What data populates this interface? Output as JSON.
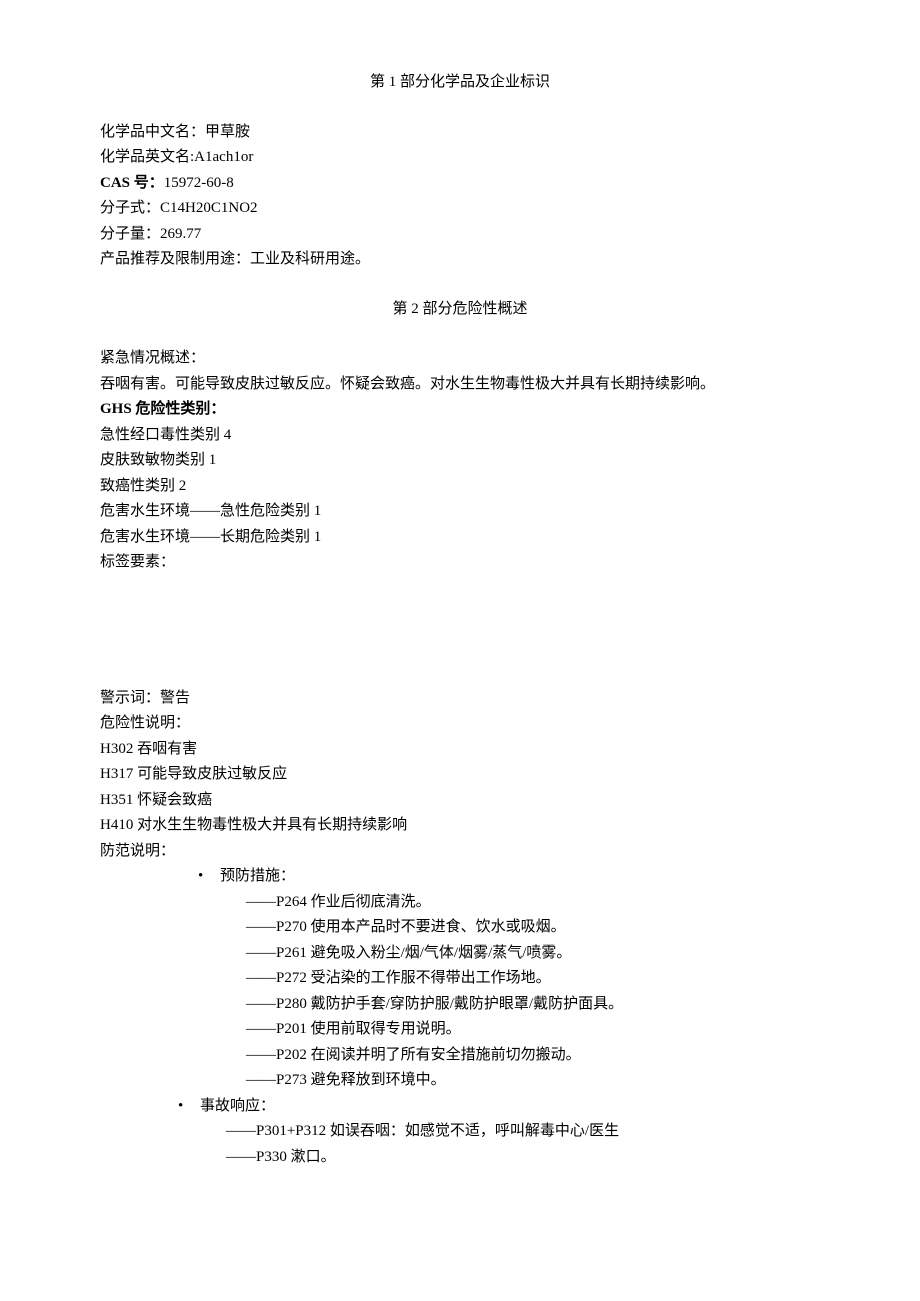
{
  "section1": {
    "title": "第 1 部分化学品及企业标识",
    "name_cn_label": "化学品中文名：",
    "name_cn": "甲草胺",
    "name_en_label": "化学品英文名:",
    "name_en": "A1ach1or",
    "cas_label": "CAS 号：",
    "cas": "15972-60-8",
    "formula_label": "分子式：",
    "formula": "C14H20C1NO2",
    "mw_label": "分子量：",
    "mw": "269.77",
    "use_label": "产品推荐及限制用途：",
    "use": "工业及科研用途。"
  },
  "section2": {
    "title": "第 2 部分危险性概述",
    "emergency_label": "紧急情况概述：",
    "emergency_text": "吞咽有害。可能导致皮肤过敏反应。怀疑会致癌。对水生生物毒性极大并具有长期持续影响。",
    "ghs_label": "GHS 危险性类别：",
    "ghs_items": [
      "急性经口毒性类别 4",
      "皮肤致敏物类别 1",
      "致癌性类别 2",
      "危害水生环境——急性危险类别 1",
      "危害水生环境——长期危险类别 1"
    ],
    "label_elements": "标签要素：",
    "signal_label": "警示词：",
    "signal": "警告",
    "hazard_label": "危险性说明：",
    "hazard_statements": [
      "H302 吞咽有害",
      "H317 可能导致皮肤过敏反应",
      "H351 怀疑会致癌",
      "H410 对水生生物毒性极大并具有长期持续影响"
    ],
    "precaution_label": "防范说明：",
    "prevention_label": "预防措施：",
    "prevention_items": [
      "——P264 作业后彻底清洗。",
      "——P270 使用本产品时不要进食、饮水或吸烟。",
      "——P261 避免吸入粉尘/烟/气体/烟雾/蒸气/喷雾。",
      "——P272 受沾染的工作服不得带出工作场地。",
      "——P280 戴防护手套/穿防护服/戴防护眼罩/戴防护面具。",
      "——P201 使用前取得专用说明。",
      "——P202 在阅读并明了所有安全措施前切勿搬动。",
      "——P273 避免释放到环境中。"
    ],
    "response_label": "事故响应：",
    "response_items": [
      "——P301+P312 如误吞咽：如感觉不适，呼叫解毒中心/医生",
      "——P330 漱口。"
    ]
  }
}
